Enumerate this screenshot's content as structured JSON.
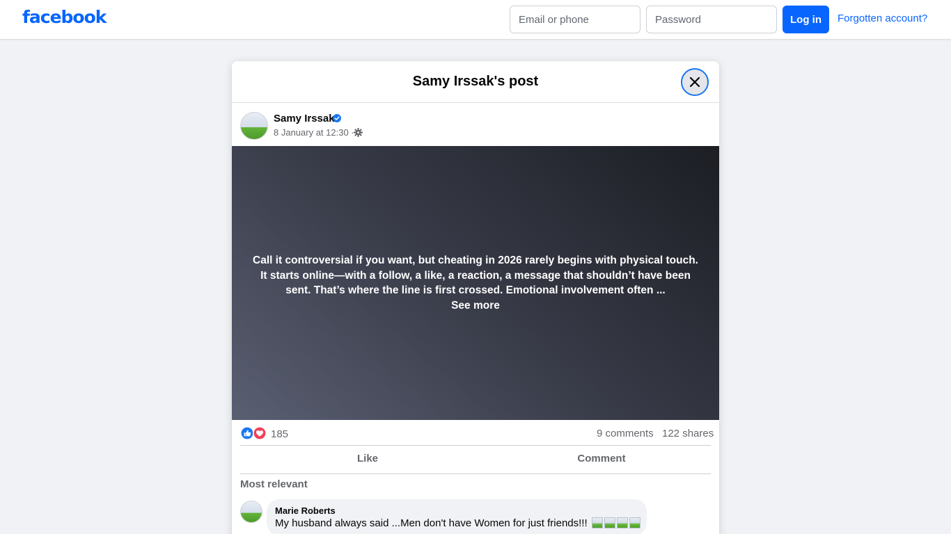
{
  "brand": {
    "name": "facebook",
    "color": "#0866ff"
  },
  "login": {
    "email_placeholder": "Email or phone",
    "password_placeholder": "Password",
    "login_label": "Log in",
    "forgot_label": "Forgotten account?"
  },
  "modal": {
    "title": "Samy Irssak's post",
    "close_icon": "close-icon"
  },
  "post": {
    "author": "Samy Irssak",
    "verified": true,
    "timestamp": "8 January at 12:30 ·",
    "audience_icon": "gear-icon",
    "text": "Call it controversial if you want, but cheating in 2026 rarely begins with physical touch. It starts online—with a follow, a like, a reaction, a message that shouldn’t have been sent. That’s where the line is first crossed. Emotional involvement often ...",
    "see_more": "See more",
    "reactions": [
      "like",
      "love"
    ],
    "reaction_count": "185",
    "comments_count": "9 comments",
    "shares_count": "122 shares"
  },
  "actions": {
    "like": "Like",
    "comment": "Comment"
  },
  "comments": {
    "filter_label": "Most relevant",
    "items": [
      {
        "author": "Marie Roberts",
        "text": "My husband always said ...Men don't have Women for just friends!!!",
        "emoji_count": 4
      }
    ]
  },
  "colors": {
    "accent": "#0866ff",
    "verified": "#1877f2",
    "like": "#1877f2",
    "love": "#f33e58"
  }
}
